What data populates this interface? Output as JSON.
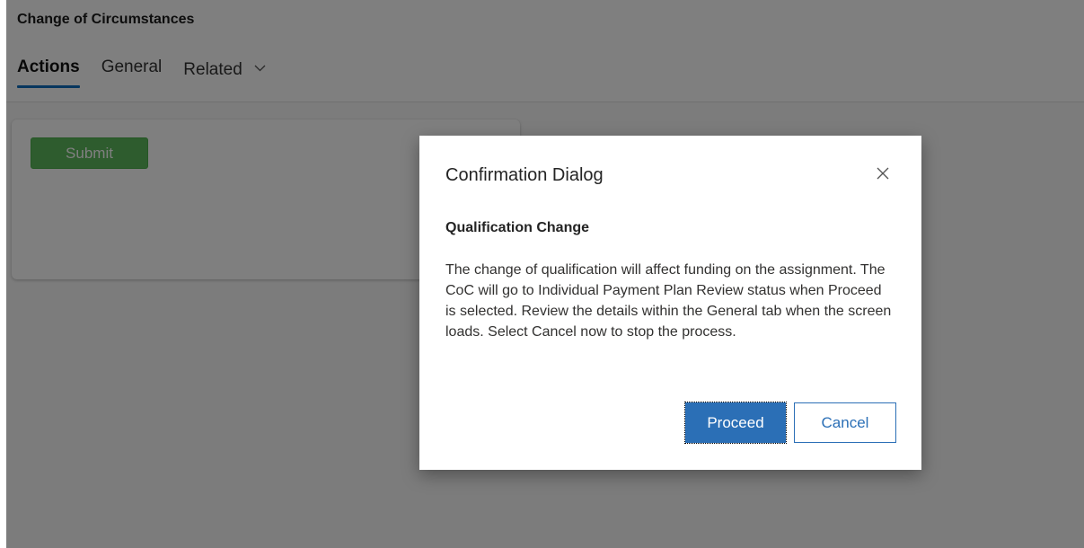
{
  "record": {
    "title": "Change of Circumstances"
  },
  "tabs": [
    {
      "label": "Actions",
      "active": true
    },
    {
      "label": "General",
      "active": false
    },
    {
      "label": "Related",
      "active": false
    }
  ],
  "card": {
    "submit_label": "Submit"
  },
  "dialog": {
    "title": "Confirmation Dialog",
    "subtitle": "Qualification Change",
    "body": "The change of qualification will affect funding on the assignment. The CoC will go to Individual Payment Plan Review status when Proceed is selected. Review the details within the General tab when the screen loads. Select Cancel now to stop the process.",
    "proceed_label": "Proceed",
    "cancel_label": "Cancel",
    "close_icon": "close-icon"
  },
  "colors": {
    "accent": "#0f6cbd",
    "primary_button": "#2b6fb6",
    "submit_button": "#5cb85c",
    "overlay": "rgba(0,0,0,0.5)"
  }
}
